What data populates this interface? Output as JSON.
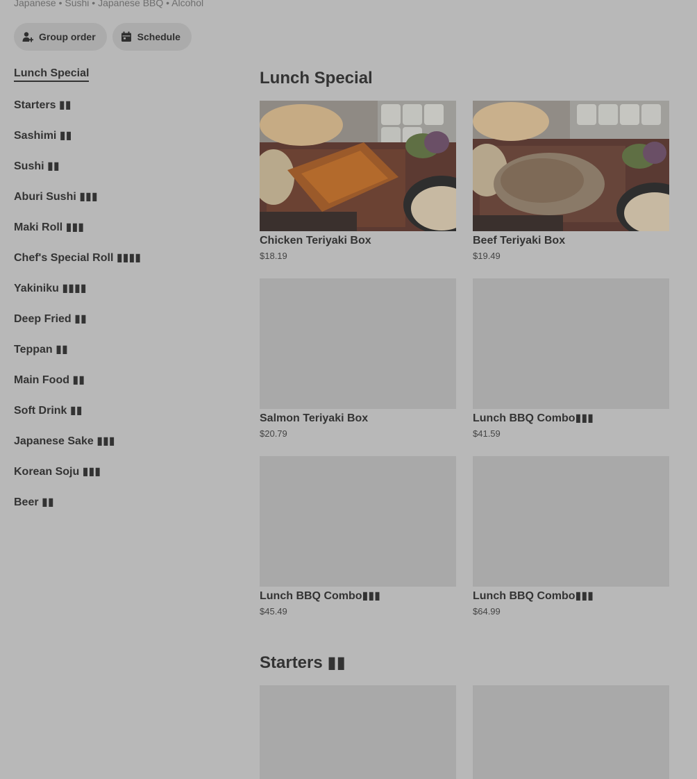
{
  "store": {
    "cuisine_line": "Japanese • Sushi • Japanese BBQ • Alcohol"
  },
  "actions": {
    "group_order": "Group order",
    "schedule": "Schedule"
  },
  "sidebar": {
    "items": [
      {
        "label": "Lunch Special",
        "active": true
      },
      {
        "label": "Starters ▮▮"
      },
      {
        "label": "Sashimi ▮▮"
      },
      {
        "label": "Sushi ▮▮"
      },
      {
        "label": "Aburi Sushi ▮▮▮"
      },
      {
        "label": "Maki Roll ▮▮▮"
      },
      {
        "label": "Chef's Special Roll ▮▮▮▮"
      },
      {
        "label": "Yakiniku ▮▮▮▮"
      },
      {
        "label": "Deep Fried ▮▮"
      },
      {
        "label": "Teppan ▮▮"
      },
      {
        "label": "Main Food ▮▮"
      },
      {
        "label": "Soft Drink ▮▮"
      },
      {
        "label": "Japanese Sake ▮▮▮"
      },
      {
        "label": "Korean Soju ▮▮▮"
      },
      {
        "label": "Beer ▮▮"
      }
    ]
  },
  "sections": [
    {
      "title": "Lunch Special",
      "items": [
        {
          "name": "Chicken Teriyaki Box",
          "price": "$18.19",
          "image": "chicken-teriyaki-photo"
        },
        {
          "name": "Beef Teriyaki Box",
          "price": "$19.49",
          "image": "beef-teriyaki-photo"
        },
        {
          "name": "Salmon Teriyaki Box",
          "price": "$20.79"
        },
        {
          "name": "Lunch BBQ Combo▮▮▮",
          "price": "$41.59"
        },
        {
          "name": "Lunch BBQ Combo▮▮▮",
          "price": "$45.49"
        },
        {
          "name": "Lunch BBQ Combo▮▮▮",
          "price": "$64.99"
        }
      ]
    },
    {
      "title": "Starters ▮▮",
      "items": [
        {
          "name": "",
          "price": ""
        },
        {
          "name": "",
          "price": ""
        }
      ]
    }
  ],
  "icons": {
    "group_order": "person-plus-icon",
    "schedule": "calendar-icon"
  }
}
